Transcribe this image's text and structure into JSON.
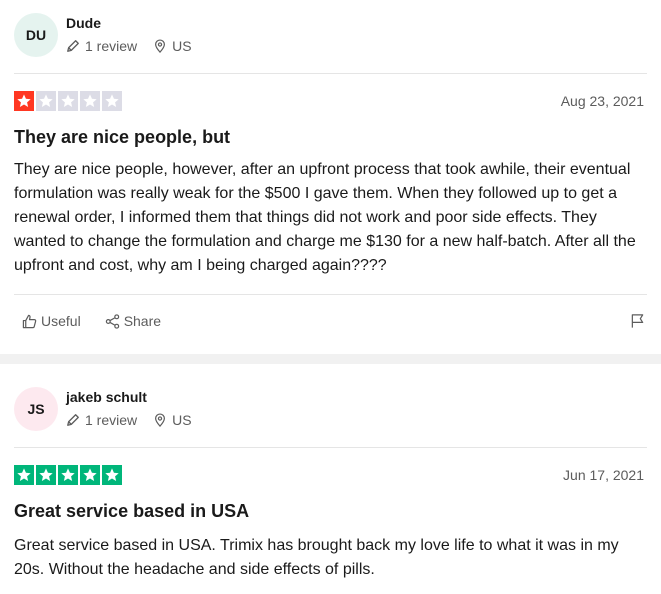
{
  "reviews": [
    {
      "avatar_initials": "DU",
      "username": "Dude",
      "review_count": "1 review",
      "country": "US",
      "rating": 1,
      "date": "Aug 23, 2021",
      "title": "They are nice people, but",
      "body": "They are nice people, however, after an upfront process that took awhile, their eventual formulation was really weak for the $500 I gave them. When they followed up to get a renewal order, I informed them that things did not work and poor side effects. They wanted to change the formulation and charge me $130 for a new half-batch. After all the upfront and cost, why am I being charged again????",
      "useful_label": "Useful",
      "share_label": "Share"
    },
    {
      "avatar_initials": "JS",
      "username": "jakeb schult",
      "review_count": "1 review",
      "country": "US",
      "rating": 5,
      "date": "Jun 17, 2021",
      "title": "Great service based in USA",
      "body": "Great service based in USA. Trimix has brought back my love life to what it was in my 20s. Without the headache and side effects of pills."
    }
  ],
  "colors": {
    "star_one_star": "#ff3722",
    "star_five_star": "#00b67a",
    "star_empty": "#dcdce6",
    "avatar_du": "#e5f3ef",
    "avatar_js": "#fde9ef"
  },
  "icons": [
    "pencil-icon",
    "location-pin-icon",
    "star-icon",
    "thumbs-up-icon",
    "share-icon",
    "flag-icon"
  ]
}
